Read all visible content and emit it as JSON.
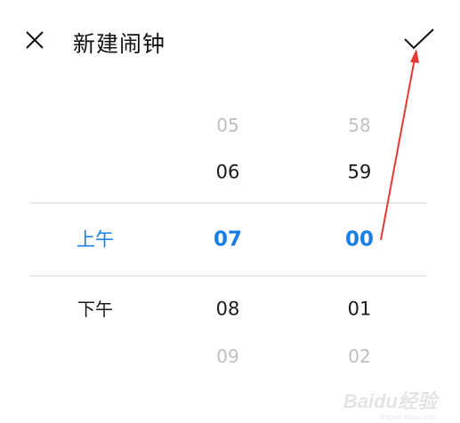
{
  "header": {
    "title": "新建闹钟",
    "close_icon": "close-icon",
    "confirm_icon": "checkmark-icon"
  },
  "picker": {
    "ampm": {
      "selected": "上午",
      "below": "下午"
    },
    "hour": {
      "above2": "05",
      "above1": "06",
      "selected": "07",
      "below1": "08",
      "below2": "09"
    },
    "minute": {
      "above2": "58",
      "above1": "59",
      "selected": "00",
      "below1": "01",
      "below2": "02"
    }
  },
  "colors": {
    "accent": "#1a7ee6",
    "annotation_arrow": "#e53935"
  },
  "watermark": {
    "text": "Baidu经验",
    "sub": "jingyan.baidu.com"
  }
}
